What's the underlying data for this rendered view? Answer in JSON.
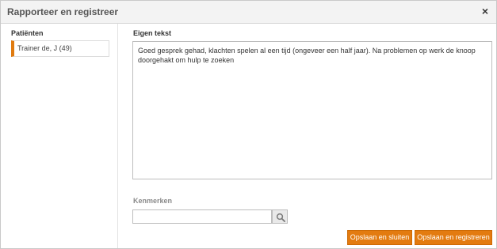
{
  "dialog": {
    "title": "Rapporteer en registreer",
    "close_glyph": "×"
  },
  "sidebar": {
    "heading": "Patiënten",
    "items": [
      {
        "label": "Trainer de, J (49)"
      }
    ]
  },
  "own_text": {
    "heading": "Eigen tekst",
    "value": "Goed gesprek gehad, klachten spelen al een tijd (ongeveer een half jaar). Na problemen op werk de knoop doorgehakt om hulp te zoeken"
  },
  "features": {
    "heading": "Kenmerken",
    "search_value": "",
    "search_icon": "search-icon"
  },
  "buttons": {
    "save_close": "Opslaan en sluiten",
    "save_register": "Opslaan en registreren"
  },
  "colors": {
    "accent": "#e37b10"
  }
}
